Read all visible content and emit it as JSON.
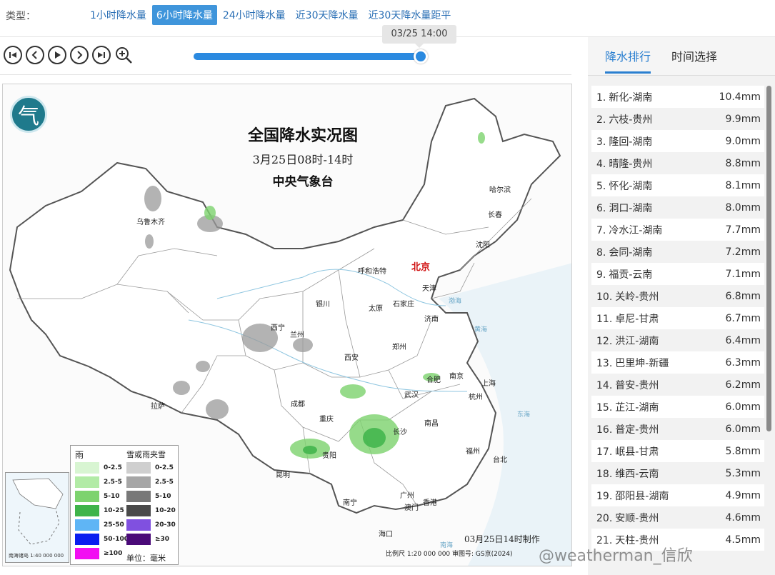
{
  "typebar": {
    "label": "类型：",
    "tabs": [
      "1小时降水量",
      "6小时降水量",
      "24小时降水量",
      "近30天降水量",
      "近30天降水量距平"
    ],
    "active_index": 1
  },
  "player": {
    "time_tooltip": "03/25 14:00",
    "progress": 1.0,
    "controls": [
      "first-icon",
      "prev-icon",
      "play-icon",
      "next-icon",
      "last-icon",
      "zoom-in-icon"
    ]
  },
  "map": {
    "title": "全国降水实况图",
    "subtitle": "3月25日08时-14时",
    "agency": "中央气象台",
    "made_time": "03月25日14时制作",
    "scale_text": "比例尺 1:20 000 000    审图号: GS京(2024)",
    "inset_caption": "南海诸岛  1:40 000 000",
    "cities": [
      "乌鲁木齐",
      "哈尔滨",
      "长春",
      "沈阳",
      "呼和浩特",
      "北京",
      "天津",
      "石家庄",
      "太原",
      "银川",
      "西宁",
      "兰州",
      "济南",
      "郑州",
      "西安",
      "南京",
      "合肥",
      "上海",
      "杭州",
      "武汉",
      "成都",
      "重庆",
      "拉萨",
      "长沙",
      "南昌",
      "福州",
      "台北",
      "贵阳",
      "昆明",
      "广州",
      "南宁",
      "澳门",
      "香港",
      "海口"
    ],
    "seas": [
      "渤海",
      "黄海",
      "东海",
      "南海"
    ],
    "legend": {
      "rain_title": "雨",
      "snow_title": "雪或雨夹雪",
      "unit": "单位：毫米",
      "rain": [
        {
          "label": "0-2.5",
          "color": "#d8f5d2"
        },
        {
          "label": "2.5-5",
          "color": "#b2eba6"
        },
        {
          "label": "5-10",
          "color": "#7dd36e"
        },
        {
          "label": "10-25",
          "color": "#3fb44a"
        },
        {
          "label": "25-50",
          "color": "#5fb5f5"
        },
        {
          "label": "50-100",
          "color": "#0a1ef0"
        },
        {
          "label": "≥100",
          "color": "#f20ef2"
        }
      ],
      "snow": [
        {
          "label": "0-2.5",
          "color": "#cfcfcf"
        },
        {
          "label": "2.5-5",
          "color": "#a6a6a6"
        },
        {
          "label": "5-10",
          "color": "#787878"
        },
        {
          "label": "10-20",
          "color": "#4a4a4a"
        },
        {
          "label": "20-30",
          "color": "#8050e0"
        },
        {
          "label": "≥30",
          "color": "#4a0a78"
        }
      ]
    }
  },
  "panel": {
    "tabs": [
      "降水排行",
      "时间选择"
    ],
    "active_index": 0,
    "ranking": [
      {
        "rank": "1.",
        "place": "新化-湖南",
        "value": "10.4mm"
      },
      {
        "rank": "2.",
        "place": "六枝-贵州",
        "value": "9.9mm"
      },
      {
        "rank": "3.",
        "place": "隆回-湖南",
        "value": "9.0mm"
      },
      {
        "rank": "4.",
        "place": "晴隆-贵州",
        "value": "8.8mm"
      },
      {
        "rank": "5.",
        "place": "怀化-湖南",
        "value": "8.1mm"
      },
      {
        "rank": "6.",
        "place": "洞口-湖南",
        "value": "8.0mm"
      },
      {
        "rank": "7.",
        "place": "冷水江-湖南",
        "value": "7.7mm"
      },
      {
        "rank": "8.",
        "place": "会同-湖南",
        "value": "7.2mm"
      },
      {
        "rank": "9.",
        "place": "福贡-云南",
        "value": "7.1mm"
      },
      {
        "rank": "10.",
        "place": "关岭-贵州",
        "value": "6.8mm"
      },
      {
        "rank": "11.",
        "place": "卓尼-甘肃",
        "value": "6.7mm"
      },
      {
        "rank": "12.",
        "place": "洪江-湖南",
        "value": "6.4mm"
      },
      {
        "rank": "13.",
        "place": "巴里坤-新疆",
        "value": "6.3mm"
      },
      {
        "rank": "14.",
        "place": "普安-贵州",
        "value": "6.2mm"
      },
      {
        "rank": "15.",
        "place": "芷江-湖南",
        "value": "6.0mm"
      },
      {
        "rank": "16.",
        "place": "普定-贵州",
        "value": "6.0mm"
      },
      {
        "rank": "17.",
        "place": "岷县-甘肃",
        "value": "5.8mm"
      },
      {
        "rank": "18.",
        "place": "维西-云南",
        "value": "5.3mm"
      },
      {
        "rank": "19.",
        "place": "邵阳县-湖南",
        "value": "4.9mm"
      },
      {
        "rank": "20.",
        "place": "安顺-贵州",
        "value": "4.6mm"
      },
      {
        "rank": "21.",
        "place": "天柱-贵州",
        "value": "4.5mm"
      }
    ]
  },
  "watermark": "@weatherman_信欣"
}
